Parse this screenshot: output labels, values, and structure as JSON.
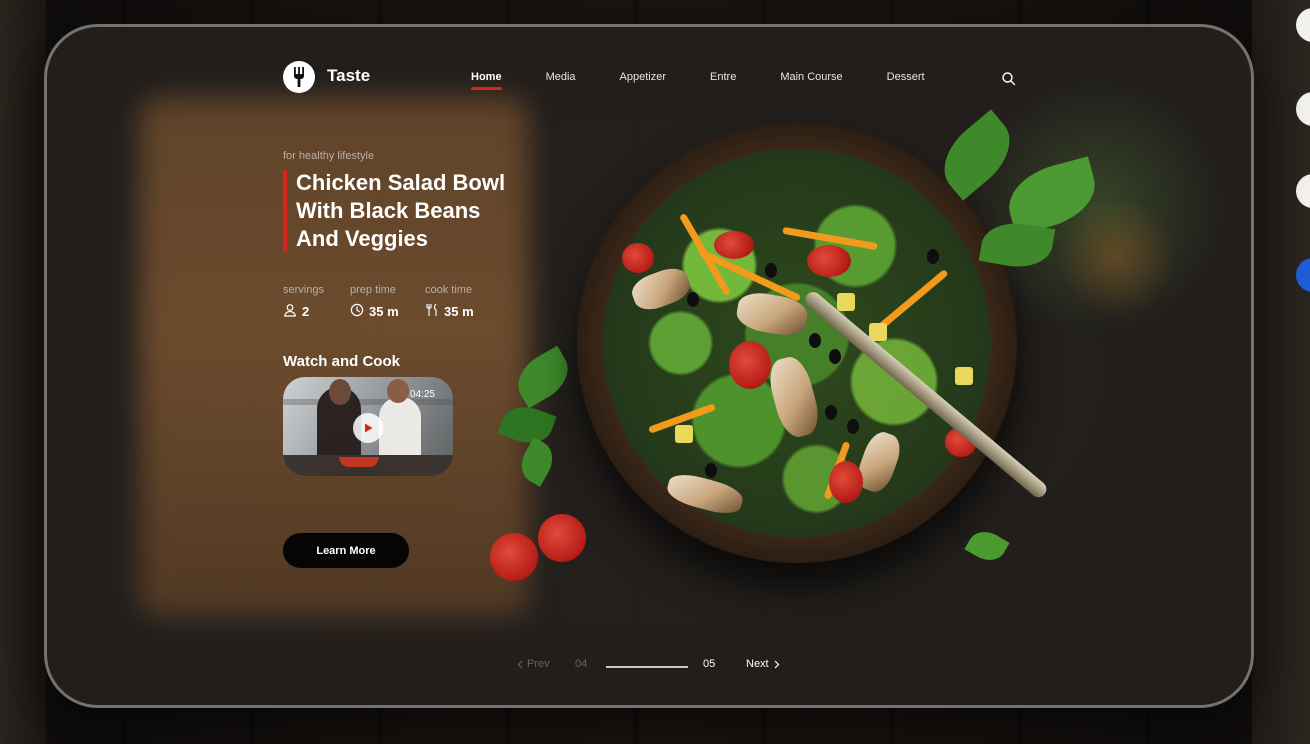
{
  "brand": {
    "name": "Taste",
    "logo_icon": "fork-icon"
  },
  "nav": {
    "items": [
      {
        "label": "Home",
        "active": true
      },
      {
        "label": "Media",
        "active": false
      },
      {
        "label": "Appetizer",
        "active": false
      },
      {
        "label": "Entre",
        "active": false
      },
      {
        "label": "Main Course",
        "active": false
      },
      {
        "label": "Dessert",
        "active": false
      }
    ],
    "search_icon": "search-icon"
  },
  "hero": {
    "kicker": "for healthy lifestyle",
    "title_lines": [
      "Chicken Salad Bowl",
      "With Black Beans",
      "And Veggies"
    ]
  },
  "stats": [
    {
      "label": "servings",
      "value": "2",
      "icon": "user-icon"
    },
    {
      "label": "prep time",
      "value": "35 m",
      "icon": "clock-icon"
    },
    {
      "label": "cook time",
      "value": "35 m",
      "icon": "utensils-icon"
    }
  ],
  "watch": {
    "title": "Watch and Cook",
    "duration": "04:25",
    "play_icon": "play-icon"
  },
  "cta": {
    "label": "Learn More"
  },
  "pagination": {
    "prev_label": "Prev",
    "next_label": "Next",
    "prev_page": "04",
    "current_page": "05",
    "progress": 1.0
  },
  "colors": {
    "accent": "#d8241f",
    "card_bg": "#221f1d",
    "button_bg": "#050505"
  }
}
